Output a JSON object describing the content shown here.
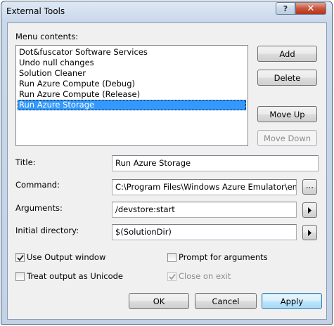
{
  "window": {
    "title": "External Tools",
    "help_glyph": "?",
    "close_glyph": "✕"
  },
  "menu_contents": {
    "label": "Menu contents:",
    "items": [
      "Dot&fuscator Software Services",
      "Undo null changes",
      "Solution Cleaner",
      "Run Azure Compute (Debug)",
      "Run Azure Compute (Release)",
      "Run Azure Storage"
    ],
    "selected_index": 5
  },
  "side_buttons": {
    "add": "Add",
    "delete": "Delete",
    "move_up": "Move Up",
    "move_down": "Move Down"
  },
  "fields": {
    "title_label": "Title:",
    "title_value": "Run Azure Storage",
    "command_label": "Command:",
    "command_value": "C:\\Program Files\\Windows Azure Emulator\\emu",
    "command_browse": "...",
    "arguments_label": "Arguments:",
    "arguments_value": "/devstore:start",
    "initial_dir_label": "Initial directory:",
    "initial_dir_value": "$(SolutionDir)"
  },
  "options": {
    "use_output_window": {
      "label": "Use Output window",
      "checked": true
    },
    "prompt_for_arguments": {
      "label": "Prompt for arguments",
      "checked": false
    },
    "treat_output_unicode": {
      "label": "Treat output as Unicode",
      "checked": false
    },
    "close_on_exit": {
      "label": "Close on exit",
      "checked": true,
      "disabled": true
    }
  },
  "dialog_buttons": {
    "ok": "OK",
    "cancel": "Cancel",
    "apply": "Apply"
  },
  "colors": {
    "selection": "#3399ff",
    "close_button": "#c8553c",
    "frame": "#c2d3e8"
  }
}
